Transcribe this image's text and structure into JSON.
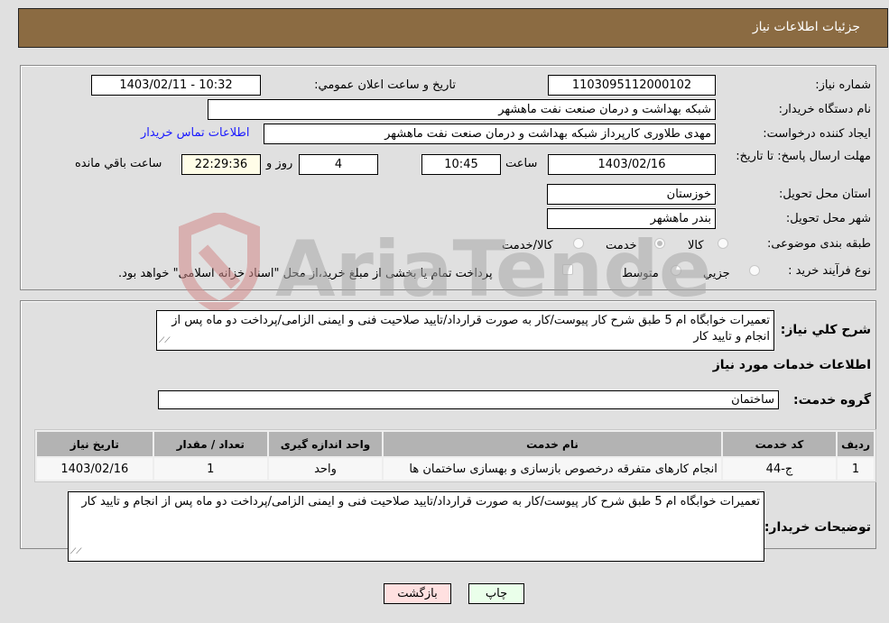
{
  "header": {
    "title": "جزئیات اطلاعات نیاز"
  },
  "details": {
    "need_number": {
      "label": "شماره نیاز:",
      "value": "1103095112000102"
    },
    "announce_datetime": {
      "label": "تاریخ و ساعت اعلان عمومي:",
      "value": "1403/02/11 - 10:32"
    },
    "buyer_org": {
      "label": "نام دستگاه خریدار:",
      "value": "شبکه بهداشت و درمان صنعت نفت ماهشهر"
    },
    "requester": {
      "label": "ایجاد کننده درخواست:",
      "value": "مهدی طلاوری کارپرداز شبکه بهداشت و درمان صنعت نفت ماهشهر"
    },
    "buyer_contact_link": "اطلاعات تماس خریدار",
    "deadline": {
      "label": "مهلت ارسال پاسخ: تا تاریخ:",
      "date": "1403/02/16",
      "time_label": "ساعت",
      "time": "10:45",
      "days": "4",
      "days_label": "روز و",
      "remaining": "22:29:36",
      "remaining_label": "ساعت باقي مانده"
    },
    "province": {
      "label": "استان محل تحویل:",
      "value": "خوزستان"
    },
    "city": {
      "label": "شهر محل تحویل:",
      "value": "بندر ماهشهر"
    },
    "category": {
      "label": "طبقه بندی موضوعی:",
      "options": [
        "کالا",
        "خدمت",
        "کالا/خدمت"
      ],
      "selected": "خدمت"
    },
    "purchase_type": {
      "label": "نوع فرآیند خرید :",
      "options": [
        "جزیي",
        "متوسط"
      ],
      "treasury_note": "پرداخت تمام یا بخشی از مبلغ خرید،از محل \"اسناد خزانه اسلامی\" خواهد بود."
    }
  },
  "description": {
    "label": "شرح کلي نیاز:",
    "value": "تعمیرات خوابگاه ام 5 طبق شرح کار پیوست/کار به صورت قرارداد/تایید صلاحیت فنی و ایمنی الزامی/پرداخت دو ماه پس از انجام و تایید کار"
  },
  "services_section": {
    "title": "اطلاعات خدمات مورد نیاز",
    "group_label": "گروه خدمت:",
    "group_value": "ساختمان",
    "table": {
      "headers": [
        "ردیف",
        "کد خدمت",
        "نام خدمت",
        "واحد اندازه گیری",
        "تعداد / مقدار",
        "تاریخ نیاز"
      ],
      "rows": [
        [
          "1",
          "ج-44",
          "انجام کارهای متفرقه درخصوص بازسازی و بهسازی ساختمان ها",
          "واحد",
          "1",
          "1403/02/16"
        ]
      ]
    }
  },
  "buyer_notes": {
    "label": "توضیحات خریدار:",
    "value": "تعمیرات خوابگاه ام 5 طبق شرح کار پیوست/کار به صورت قرارداد/تایید صلاحیت فنی و ایمنی الزامی/پرداخت دو ماه پس از انجام و تایید کار"
  },
  "buttons": {
    "print": "چاپ",
    "back": "بازگشت"
  },
  "watermark": {
    "text": "AriaTender.neT"
  },
  "colors": {
    "header": "#8b6b42",
    "print_button": "#eaffea",
    "back_button": "#ffe0e0",
    "link": "#1a1aff"
  }
}
